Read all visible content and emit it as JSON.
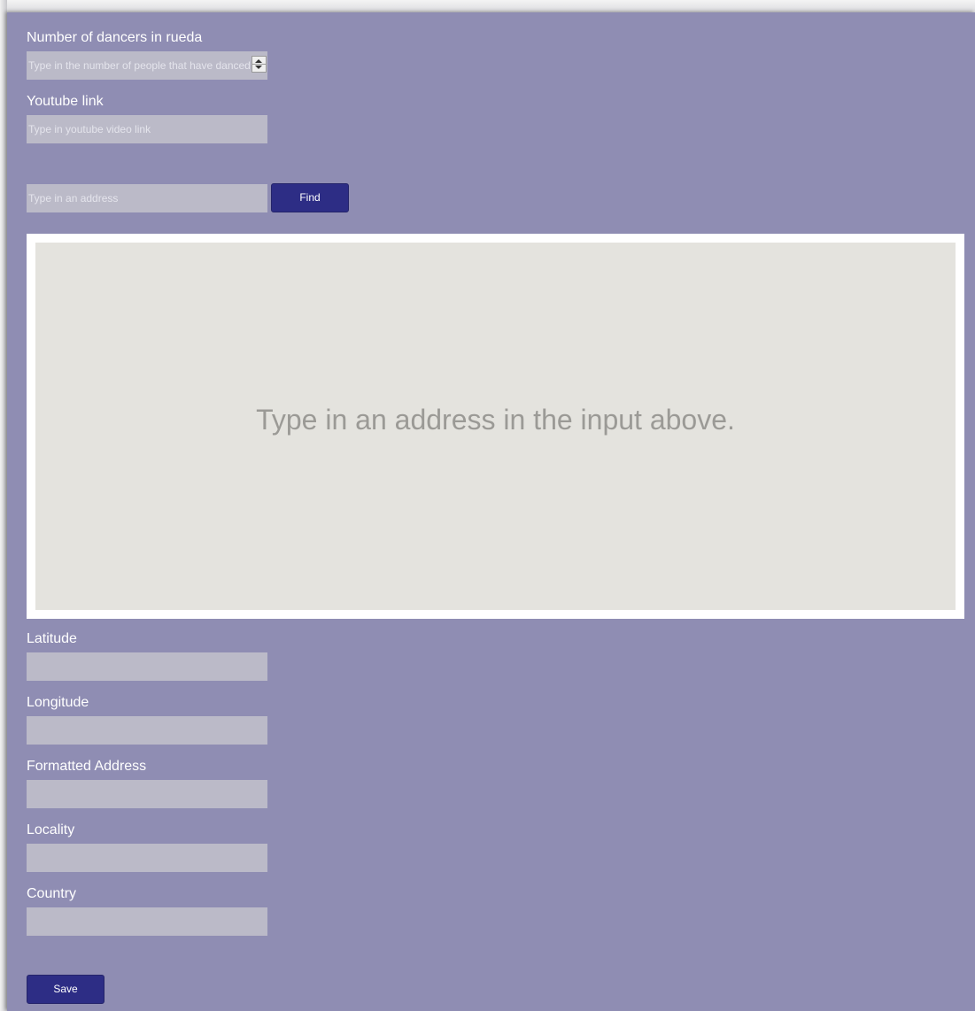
{
  "form": {
    "dancers": {
      "label": "Number of dancers in rueda",
      "placeholder": "Type in the number of people that have danced"
    },
    "youtube": {
      "label": "Youtube link",
      "placeholder": "Type in youtube video link"
    },
    "address": {
      "placeholder": "Type in an address",
      "find_label": "Find"
    },
    "map": {
      "message": "Type in an address in the input above."
    },
    "latitude": {
      "label": "Latitude",
      "value": ""
    },
    "longitude": {
      "label": "Longitude",
      "value": ""
    },
    "formatted_address": {
      "label": "Formatted Address",
      "value": ""
    },
    "locality": {
      "label": "Locality",
      "value": ""
    },
    "country": {
      "label": "Country",
      "value": ""
    },
    "save_label": "Save"
  },
  "colors": {
    "panel_background": "#8f8db3",
    "field_background": "#bbbac8",
    "button_background": "#2d2d85",
    "map_background": "#e4e3de"
  }
}
